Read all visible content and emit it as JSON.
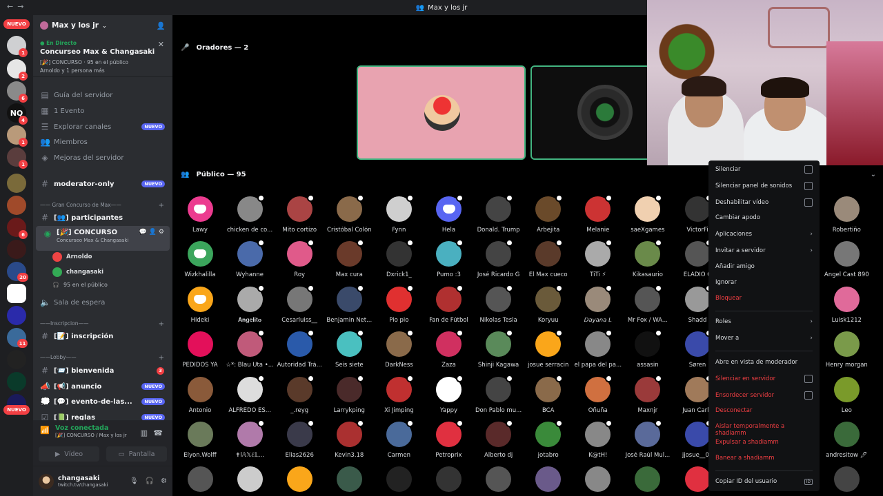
{
  "window": {
    "title": "Max y los jr"
  },
  "server": {
    "name": "Max y los jr"
  },
  "live": {
    "status": "En Directo",
    "title": "Concurseo Max & Changasaki",
    "meta": "[🎉] CONCURSO · 95 en el público",
    "people": "Arnoldo y 1 persona más"
  },
  "guild_badges": {
    "top": "NUEVO",
    "bottom": "NUEVO",
    "counts": [
      "1",
      "2",
      "6",
      "4",
      "1",
      "1",
      "6",
      "20",
      "11"
    ]
  },
  "nav": [
    {
      "label": "Guía del servidor"
    },
    {
      "label": "1 Evento"
    },
    {
      "label": "Explorar canales",
      "badge": "NUEVO"
    },
    {
      "label": "Miembros"
    },
    {
      "label": "Mejoras del servidor"
    }
  ],
  "channels": {
    "moderator": {
      "label": "moderator-only",
      "badge": "NUEVO"
    },
    "cat1": "—— Gran Concurso de Max——",
    "participantes": "[👥] participantes",
    "concurso": "[🎉] CONCURSO",
    "concurso_sub": "Concurseo Max & Changasaki",
    "speaker1": "Arnoldo",
    "speaker2": "changasaki",
    "audience": "95 en el público",
    "sala": "Sala de espera",
    "cat2": "——Inscripcion——",
    "inscripcion": "[📝] inscripción",
    "cat3": "——Lobby——",
    "bienvenida": {
      "label": "[📨] bienvenida",
      "count": "3"
    },
    "anuncio": {
      "label": "[📢] anuncio",
      "badge": "NUEVO"
    },
    "evento": {
      "label": "[💬] evento-de-las...",
      "badge": "NUEVO"
    },
    "reglas": {
      "label": "[📗] reglas",
      "badge": "NUEVO"
    }
  },
  "voice": {
    "connected": "Voz conectada",
    "location": "[🎉] CONCURSO / Max y los jr",
    "video": "Vídeo",
    "screen": "Pantalla"
  },
  "user": {
    "name": "changasaki",
    "status": "twitch.tv/changasaki"
  },
  "stage": {
    "speakers_header": "Oradores — 2",
    "audience_header": "Público — 95"
  },
  "audience": [
    "Lawy",
    "chicken de co...",
    "Mito cortizo",
    "Cristóbal Colón",
    "Fynn",
    "Hela",
    "Donald. Trump",
    "Arbejita",
    "Melanie",
    "saeXgames",
    "VictorFi",
    "",
    "",
    "Robertiño",
    "Wizkhalilla",
    "Wyhanne",
    "Roy",
    "Max cura",
    "Dxrick1_",
    "Pumo :3",
    "José Ricardo G",
    "El Max cueco",
    "TiTi ⚡",
    "Kikasaurio",
    "ELADIO C",
    "",
    "",
    "Angel Cast 890",
    "Hideki",
    "𝐀𝐧𝐠𝐞𝐥𝐢𝐭𝐨",
    "Cesarluiss__",
    "Benjamin Net...",
    "Pio pio",
    "Fan de Fútbol",
    "Nikolas Tesla",
    "Koryuu",
    "𝘋𝘢𝘺𝘢𝘯𝘢 𝘓",
    "Mr Fox / WA...",
    "Shadd",
    "",
    "",
    "Luisk1212",
    "PEDIDOS YA",
    "☆*: Blau Uta •...",
    "Autoridad Trá...",
    "Seis siete",
    "DarkNess",
    "Zaza",
    "Shinji Kagawa",
    "josue serracin",
    "el papa del pa...",
    "assasin",
    "Søren",
    "",
    "",
    "Henry morgan",
    "Antonio",
    "ALFREDO ES...",
    "_.reyg",
    "Larrykping",
    "Xi Jimping",
    "Yappy",
    "Don Pablo mu...",
    "BCA",
    "Oñuña",
    "Maxnjr",
    "Juan Carlo",
    "",
    "",
    "Leo",
    "Elyon.Wolff",
    "✝ꟾ𝔸𝕏ℰ𝕃...",
    "Elias2626",
    "Kevin3.18",
    "Carmen",
    "Petroprix",
    "Alberto dj",
    "jotabro",
    "K@tH!",
    "José Raúl Mul...",
    "jjosue__09",
    "",
    "",
    "andresitow 🖊"
  ],
  "context_menu": {
    "items": [
      {
        "label": "Silenciar",
        "type": "check"
      },
      {
        "label": "Silenciar panel de sonidos",
        "type": "check"
      },
      {
        "label": "Deshabilitar vídeo",
        "type": "check"
      },
      {
        "label": "Cambiar apodo"
      },
      {
        "label": "Aplicaciones",
        "type": "arrow"
      },
      {
        "label": "Invitar a servidor",
        "type": "arrow"
      },
      {
        "label": "Añadir amigo"
      },
      {
        "label": "Ignorar"
      },
      {
        "label": "Bloquear",
        "red": true
      },
      {
        "label": "Roles",
        "type": "arrow"
      },
      {
        "label": "Mover a",
        "type": "arrow"
      },
      {
        "label": "Abre en vista de moderador"
      },
      {
        "label": "Silenciar en servidor",
        "type": "check",
        "red": true
      },
      {
        "label": "Ensordecer servidor",
        "type": "check",
        "red": true
      },
      {
        "label": "Desconectar",
        "red": true
      },
      {
        "label": "Aislar temporalmente a shadiamm",
        "red": true
      },
      {
        "label": "Expulsar a shadiamm",
        "red": true
      },
      {
        "label": "Banear a shadiamm",
        "red": true
      },
      {
        "label": "Copiar ID del usuario",
        "type": "id"
      }
    ],
    "id_badge": "ID"
  },
  "colors": {
    "accent": "#5865f2",
    "danger": "#f23f43",
    "online": "#23a55a",
    "speaker_tile": "#e8a3b0"
  }
}
